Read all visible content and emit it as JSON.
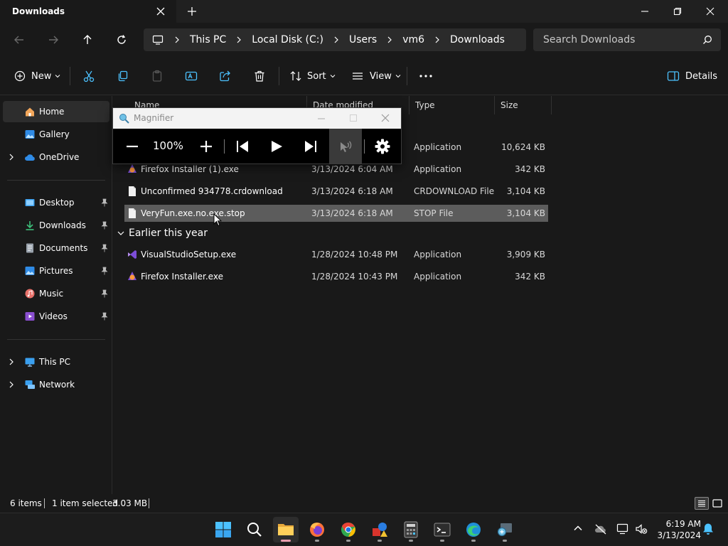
{
  "window": {
    "tab_title": "Downloads"
  },
  "address": {
    "crumbs": [
      "This PC",
      "Local Disk (C:)",
      "Users",
      "vm6",
      "Downloads"
    ]
  },
  "search": {
    "placeholder": "Search Downloads"
  },
  "toolbar": {
    "new_label": "New",
    "sort_label": "Sort",
    "view_label": "View",
    "details_label": "Details"
  },
  "sidebar": {
    "items": [
      {
        "label": "Home"
      },
      {
        "label": "Gallery"
      },
      {
        "label": "OneDrive"
      },
      {
        "label": "Desktop"
      },
      {
        "label": "Downloads"
      },
      {
        "label": "Documents"
      },
      {
        "label": "Pictures"
      },
      {
        "label": "Music"
      },
      {
        "label": "Videos"
      },
      {
        "label": "This PC"
      },
      {
        "label": "Network"
      }
    ]
  },
  "columns": {
    "name": "Name",
    "date": "Date modified",
    "type": "Type",
    "size": "Size"
  },
  "groups": {
    "earlier": "Earlier this year"
  },
  "files": [
    {
      "name": "",
      "date": "",
      "type": "Application",
      "size": "10,624 KB"
    },
    {
      "name": "Firefox Installer (1).exe",
      "date": "3/13/2024 6:04 AM",
      "type": "Application",
      "size": "342 KB"
    },
    {
      "name": "Unconfirmed 934778.crdownload",
      "date": "3/13/2024 6:18 AM",
      "type": "CRDOWNLOAD File",
      "size": "3,104 KB"
    },
    {
      "name": "VeryFun.exe.no.exe.stop",
      "date": "3/13/2024 6:18 AM",
      "type": "STOP File",
      "size": "3,104 KB"
    },
    {
      "name": "VisualStudioSetup.exe",
      "date": "1/28/2024 10:48 PM",
      "type": "Application",
      "size": "3,909 KB"
    },
    {
      "name": "Firefox Installer.exe",
      "date": "1/28/2024 10:43 PM",
      "type": "Application",
      "size": "342 KB"
    }
  ],
  "magnifier": {
    "title": "Magnifier",
    "zoom": "100%"
  },
  "status": {
    "item_count": "6 items",
    "selection": "1 item selected",
    "selection_size": "3.03 MB"
  },
  "clock": {
    "time": "6:19 AM",
    "date": "3/13/2024"
  },
  "colors": {
    "background": "#191919",
    "selected_row": "#5c5c5c",
    "accent": "#4cc2ff"
  }
}
